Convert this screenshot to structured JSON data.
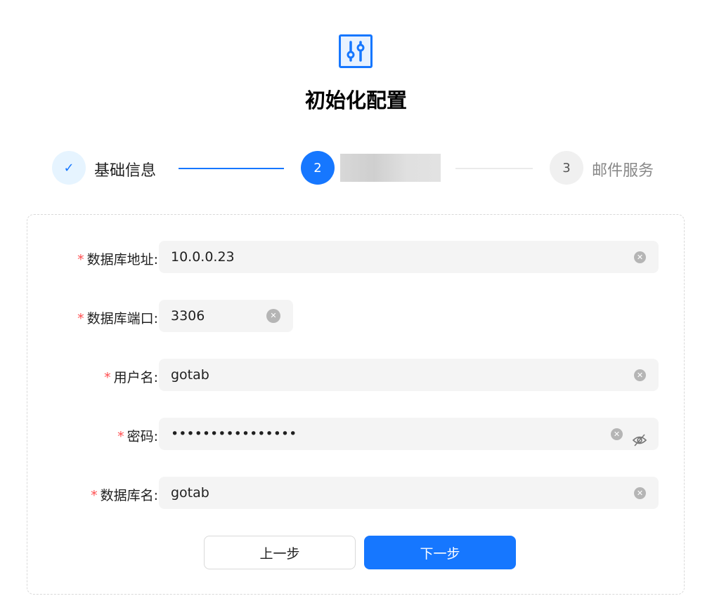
{
  "header": {
    "title": "初始化配置",
    "logo_icon": "sliders-icon"
  },
  "steps": [
    {
      "number": "1",
      "label": "基础信息",
      "status": "finished"
    },
    {
      "number": "2",
      "label": "",
      "status": "current"
    },
    {
      "number": "3",
      "label": "邮件服务",
      "status": "waiting"
    }
  ],
  "form": {
    "fields": [
      {
        "label": "数据库地址",
        "value": "10.0.0.23",
        "required": true
      },
      {
        "label": "数据库端口",
        "value": "3306",
        "required": true
      },
      {
        "label": "用户名",
        "value": "gotab",
        "required": true
      },
      {
        "label": "密码",
        "value": "••••••••••••••••",
        "required": true
      },
      {
        "label": "数据库名",
        "value": "gotab",
        "required": true
      }
    ],
    "required_mark": "*",
    "colon": ":"
  },
  "buttons": {
    "prev": "上一步",
    "next": "下一步"
  },
  "colors": {
    "primary": "#1677ff",
    "required": "#ff4d4f"
  }
}
